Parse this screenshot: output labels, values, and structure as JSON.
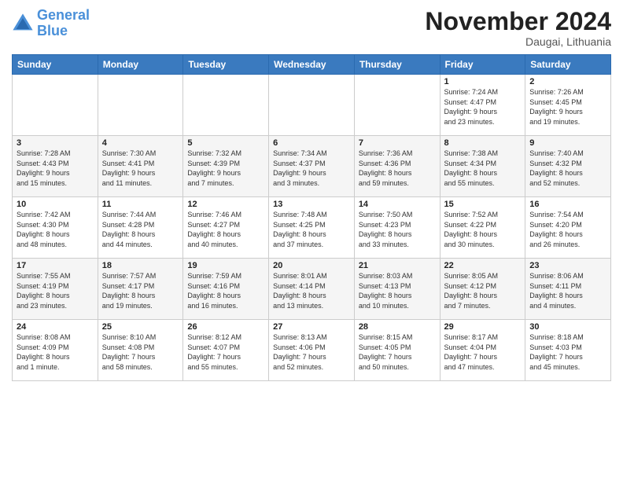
{
  "header": {
    "logo_line1": "General",
    "logo_line2": "Blue",
    "month_title": "November 2024",
    "location": "Daugai, Lithuania"
  },
  "weekdays": [
    "Sunday",
    "Monday",
    "Tuesday",
    "Wednesday",
    "Thursday",
    "Friday",
    "Saturday"
  ],
  "weeks": [
    [
      {
        "day": "",
        "info": ""
      },
      {
        "day": "",
        "info": ""
      },
      {
        "day": "",
        "info": ""
      },
      {
        "day": "",
        "info": ""
      },
      {
        "day": "",
        "info": ""
      },
      {
        "day": "1",
        "info": "Sunrise: 7:24 AM\nSunset: 4:47 PM\nDaylight: 9 hours\nand 23 minutes."
      },
      {
        "day": "2",
        "info": "Sunrise: 7:26 AM\nSunset: 4:45 PM\nDaylight: 9 hours\nand 19 minutes."
      }
    ],
    [
      {
        "day": "3",
        "info": "Sunrise: 7:28 AM\nSunset: 4:43 PM\nDaylight: 9 hours\nand 15 minutes."
      },
      {
        "day": "4",
        "info": "Sunrise: 7:30 AM\nSunset: 4:41 PM\nDaylight: 9 hours\nand 11 minutes."
      },
      {
        "day": "5",
        "info": "Sunrise: 7:32 AM\nSunset: 4:39 PM\nDaylight: 9 hours\nand 7 minutes."
      },
      {
        "day": "6",
        "info": "Sunrise: 7:34 AM\nSunset: 4:37 PM\nDaylight: 9 hours\nand 3 minutes."
      },
      {
        "day": "7",
        "info": "Sunrise: 7:36 AM\nSunset: 4:36 PM\nDaylight: 8 hours\nand 59 minutes."
      },
      {
        "day": "8",
        "info": "Sunrise: 7:38 AM\nSunset: 4:34 PM\nDaylight: 8 hours\nand 55 minutes."
      },
      {
        "day": "9",
        "info": "Sunrise: 7:40 AM\nSunset: 4:32 PM\nDaylight: 8 hours\nand 52 minutes."
      }
    ],
    [
      {
        "day": "10",
        "info": "Sunrise: 7:42 AM\nSunset: 4:30 PM\nDaylight: 8 hours\nand 48 minutes."
      },
      {
        "day": "11",
        "info": "Sunrise: 7:44 AM\nSunset: 4:28 PM\nDaylight: 8 hours\nand 44 minutes."
      },
      {
        "day": "12",
        "info": "Sunrise: 7:46 AM\nSunset: 4:27 PM\nDaylight: 8 hours\nand 40 minutes."
      },
      {
        "day": "13",
        "info": "Sunrise: 7:48 AM\nSunset: 4:25 PM\nDaylight: 8 hours\nand 37 minutes."
      },
      {
        "day": "14",
        "info": "Sunrise: 7:50 AM\nSunset: 4:23 PM\nDaylight: 8 hours\nand 33 minutes."
      },
      {
        "day": "15",
        "info": "Sunrise: 7:52 AM\nSunset: 4:22 PM\nDaylight: 8 hours\nand 30 minutes."
      },
      {
        "day": "16",
        "info": "Sunrise: 7:54 AM\nSunset: 4:20 PM\nDaylight: 8 hours\nand 26 minutes."
      }
    ],
    [
      {
        "day": "17",
        "info": "Sunrise: 7:55 AM\nSunset: 4:19 PM\nDaylight: 8 hours\nand 23 minutes."
      },
      {
        "day": "18",
        "info": "Sunrise: 7:57 AM\nSunset: 4:17 PM\nDaylight: 8 hours\nand 19 minutes."
      },
      {
        "day": "19",
        "info": "Sunrise: 7:59 AM\nSunset: 4:16 PM\nDaylight: 8 hours\nand 16 minutes."
      },
      {
        "day": "20",
        "info": "Sunrise: 8:01 AM\nSunset: 4:14 PM\nDaylight: 8 hours\nand 13 minutes."
      },
      {
        "day": "21",
        "info": "Sunrise: 8:03 AM\nSunset: 4:13 PM\nDaylight: 8 hours\nand 10 minutes."
      },
      {
        "day": "22",
        "info": "Sunrise: 8:05 AM\nSunset: 4:12 PM\nDaylight: 8 hours\nand 7 minutes."
      },
      {
        "day": "23",
        "info": "Sunrise: 8:06 AM\nSunset: 4:11 PM\nDaylight: 8 hours\nand 4 minutes."
      }
    ],
    [
      {
        "day": "24",
        "info": "Sunrise: 8:08 AM\nSunset: 4:09 PM\nDaylight: 8 hours\nand 1 minute."
      },
      {
        "day": "25",
        "info": "Sunrise: 8:10 AM\nSunset: 4:08 PM\nDaylight: 7 hours\nand 58 minutes."
      },
      {
        "day": "26",
        "info": "Sunrise: 8:12 AM\nSunset: 4:07 PM\nDaylight: 7 hours\nand 55 minutes."
      },
      {
        "day": "27",
        "info": "Sunrise: 8:13 AM\nSunset: 4:06 PM\nDaylight: 7 hours\nand 52 minutes."
      },
      {
        "day": "28",
        "info": "Sunrise: 8:15 AM\nSunset: 4:05 PM\nDaylight: 7 hours\nand 50 minutes."
      },
      {
        "day": "29",
        "info": "Sunrise: 8:17 AM\nSunset: 4:04 PM\nDaylight: 7 hours\nand 47 minutes."
      },
      {
        "day": "30",
        "info": "Sunrise: 8:18 AM\nSunset: 4:03 PM\nDaylight: 7 hours\nand 45 minutes."
      }
    ]
  ]
}
